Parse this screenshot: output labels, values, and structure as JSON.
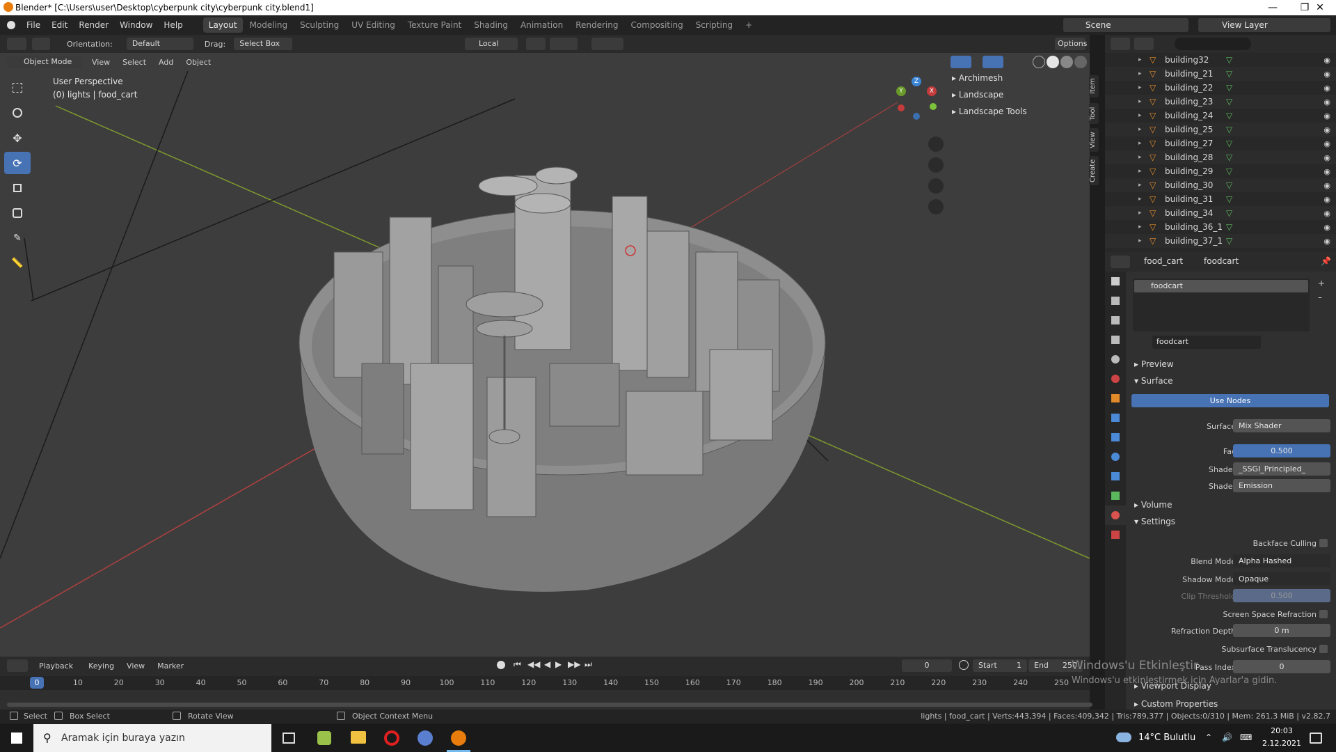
{
  "window": {
    "title": "Blender* [C:\\Users\\user\\Desktop\\cyberpunk city\\cyberpunk city.blend1]"
  },
  "menu": [
    "File",
    "Edit",
    "Render",
    "Window",
    "Help"
  ],
  "workspaces": [
    "Layout",
    "Modeling",
    "Sculpting",
    "UV Editing",
    "Texture Paint",
    "Shading",
    "Animation",
    "Rendering",
    "Compositing",
    "Scripting"
  ],
  "workspace_add": "+",
  "scene": "Scene",
  "view_layer": "View Layer",
  "tool_header": {
    "orientation_label": "Orientation:",
    "orientation_value": "Default",
    "drag_label": "Drag:",
    "drag_value": "Select Box",
    "pivot_value": "Local",
    "options": "Options"
  },
  "viewport_header": {
    "mode": "Object Mode",
    "menus": [
      "View",
      "Select",
      "Add",
      "Object"
    ]
  },
  "viewport": {
    "perspective": "User Perspective",
    "object_info": "(0) lights | food_cart"
  },
  "n_panel": {
    "items": [
      "Archimesh",
      "Landscape",
      "Landscape Tools"
    ],
    "tabs": [
      "Item",
      "Tool",
      "View",
      "Create"
    ]
  },
  "gizmo": {
    "z": "Z",
    "x": "X",
    "y": "Y"
  },
  "outliner": {
    "items": [
      "building32",
      "building_21",
      "building_22",
      "building_23",
      "building_24",
      "building_25",
      "building_27",
      "building_28",
      "building_29",
      "building_30",
      "building_31",
      "building_34",
      "building_36_1",
      "building_37_1"
    ]
  },
  "properties": {
    "object_name": "food_cart",
    "material_name": "foodcart",
    "slot_name": "foodcart",
    "datablock": "foodcart",
    "sections": {
      "preview": "Preview",
      "surface": "Surface",
      "volume": "Volume",
      "settings": "Settings",
      "viewport_display": "Viewport Display",
      "custom_props": "Custom Properties"
    },
    "use_nodes": "Use Nodes",
    "surface_label": "Surface",
    "surface_value": "Mix Shader",
    "fac_label": "Fac",
    "fac_value": "0.500",
    "fac_fraction": 0.5,
    "shader1_label": "Shader",
    "shader1_value": "_SSGI_Principled_",
    "shader2_label": "Shader",
    "shader2_value": "Emission",
    "backface_label": "Backface Culling",
    "blend_label": "Blend Mode",
    "blend_value": "Alpha Hashed",
    "shadow_label": "Shadow Mode",
    "shadow_value": "Opaque",
    "clip_label": "Clip Threshold",
    "clip_value": "0.500",
    "ssr_label": "Screen Space Refraction",
    "refr_label": "Refraction Depth",
    "refr_value": "0 m",
    "sst_label": "Subsurface Translucency",
    "pass_label": "Pass Index",
    "pass_value": "0"
  },
  "timeline": {
    "menus": [
      "Playback",
      "Keying",
      "View",
      "Marker"
    ],
    "current_frame": "0",
    "start_label": "Start",
    "start_value": "1",
    "end_label": "End",
    "end_value": "250",
    "ruler": [
      "0",
      "10",
      "20",
      "30",
      "40",
      "50",
      "60",
      "70",
      "80",
      "90",
      "100",
      "110",
      "120",
      "130",
      "140",
      "150",
      "160",
      "170",
      "180",
      "190",
      "200",
      "210",
      "220",
      "230",
      "240",
      "250"
    ]
  },
  "statusbar": {
    "select": "Select",
    "box_select": "Box Select",
    "rotate_view": "Rotate View",
    "context_menu": "Object Context Menu",
    "stats": "lights | food_cart | Verts:443,394 | Faces:409,342 | Tris:789,377 | Objects:0/310 | Mem: 261.3 MiB | v2.82.7"
  },
  "watermark": {
    "line1": "Windows'u Etkinleştir",
    "line2": "Windows'u etkinleştirmek için Ayarlar'a gidin."
  },
  "taskbar": {
    "search_placeholder": "Aramak için buraya yazın",
    "weather": "14°C  Bulutlu",
    "time": "20:03",
    "date": "2.12.2021"
  },
  "colors": {
    "accent": "#4772b3",
    "viewport_bg": "#3d3d3d",
    "header_bg": "#2b2b2b"
  }
}
